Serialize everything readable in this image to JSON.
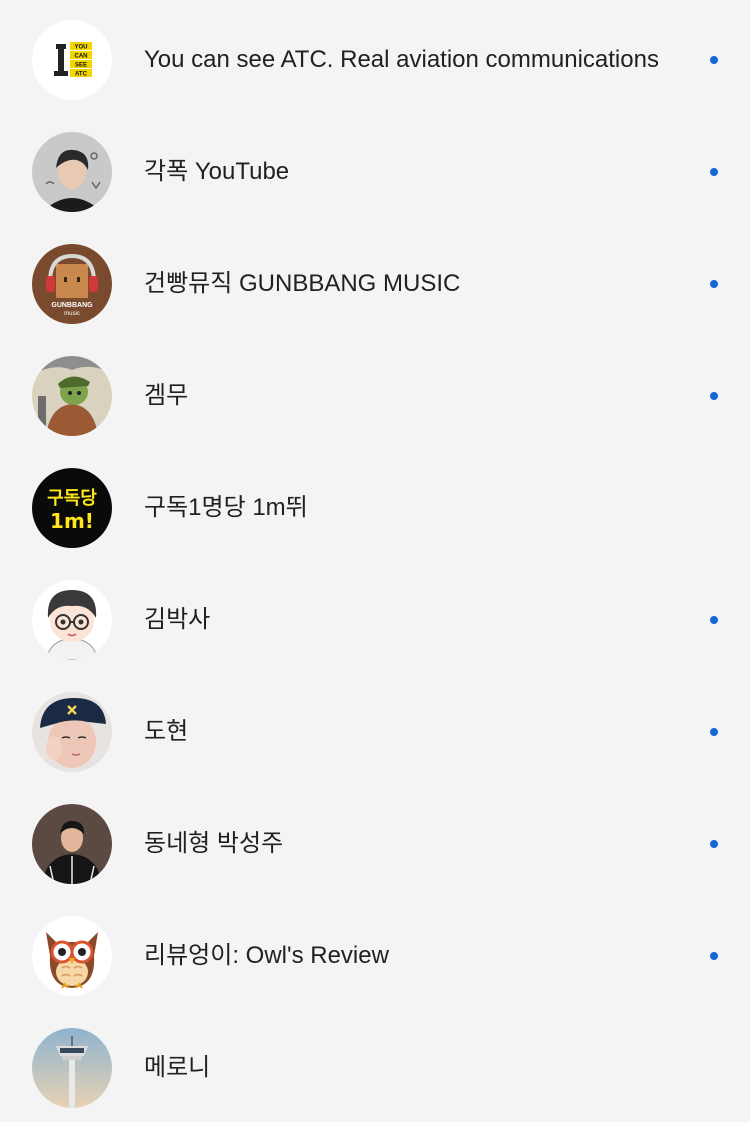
{
  "accent_color": "#1565d8",
  "channels": [
    {
      "name": "You can see ATC. Real aviation communications",
      "avatar_icon": "atc-logo-icon",
      "avatar_text": [
        "YOU",
        "CAN",
        "SEE",
        "ATC"
      ],
      "has_new": true
    },
    {
      "name": "각폭 YouTube",
      "avatar_icon": "person-photo-icon",
      "has_new": true
    },
    {
      "name": "건빵뮤직 GUNBBANG MUSIC",
      "avatar_icon": "gunbbang-headphones-icon",
      "avatar_text": [
        "GUNBBANG",
        "music"
      ],
      "has_new": true
    },
    {
      "name": "겜무",
      "avatar_icon": "cartoon-soldier-icon",
      "has_new": true
    },
    {
      "name": "구독1명당 1m뛰",
      "avatar_icon": "text-logo-icon",
      "avatar_text": [
        "구독당",
        "1m!"
      ],
      "has_new": false
    },
    {
      "name": "김박사",
      "avatar_icon": "cartoon-glasses-boy-icon",
      "has_new": true
    },
    {
      "name": "도현",
      "avatar_icon": "person-cap-icon",
      "has_new": true
    },
    {
      "name": "동네형 박성주",
      "avatar_icon": "person-tracksuit-icon",
      "has_new": true
    },
    {
      "name": "리뷰엉이: Owl's Review",
      "avatar_icon": "owl-icon",
      "has_new": true
    },
    {
      "name": "메로니",
      "avatar_icon": "control-tower-icon",
      "has_new": false
    }
  ]
}
